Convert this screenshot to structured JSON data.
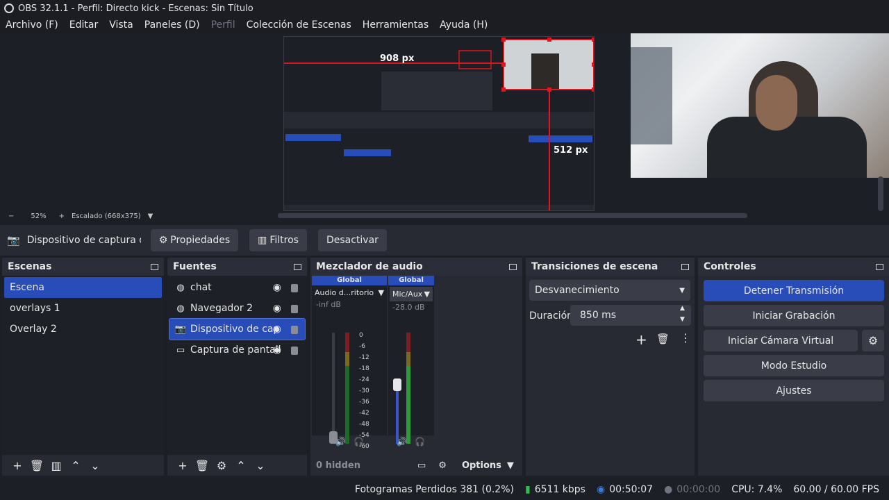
{
  "window": {
    "title": "OBS 32.1.1 - Perfil: Directo kick - Escenas: Sin Título"
  },
  "menu": [
    "Archivo (F)",
    "Editar",
    "Vista",
    "Paneles (D)",
    "Perfil",
    "Colección de Escenas",
    "Herramientas",
    "Ayuda (H)"
  ],
  "preview": {
    "overlay_px_h": "908 px",
    "overlay_px_v": "512 px"
  },
  "zoom": {
    "minus": "−",
    "level": "52%",
    "plus": "+",
    "scaling": "Escalado (668x375)"
  },
  "source_toolbar": {
    "source_name": "Dispositivo de captura de v",
    "properties": "Propiedades",
    "filters": "Filtros",
    "deactivate": "Desactivar"
  },
  "scenes": {
    "title": "Escenas",
    "items": [
      "Escena",
      "overlays 1",
      "Overlay 2"
    ]
  },
  "sources": {
    "title": "Fuentes",
    "items": [
      {
        "label": "chat",
        "icon": "globe-icon"
      },
      {
        "label": "Navegador 2",
        "icon": "globe-icon"
      },
      {
        "label": "Dispositivo de cap",
        "icon": "camera-icon"
      },
      {
        "label": "Captura de pantall",
        "icon": "monitor-icon"
      }
    ]
  },
  "mixer": {
    "title": "Mezclador de audio",
    "channels": [
      {
        "head": "Global",
        "name": "Audio d...ritorio",
        "db": "-inf dB"
      },
      {
        "head": "Global",
        "name": "Mic/Aux",
        "db": "-28.0 dB"
      }
    ],
    "ticks": [
      "0",
      "-6",
      "-12",
      "-18",
      "-24",
      "-30",
      "-36",
      "-42",
      "-48",
      "-54",
      "-60"
    ],
    "hidden": "0 hidden",
    "options": "Options"
  },
  "transitions": {
    "title": "Transiciones de escena",
    "selected": "Desvanecimiento",
    "duration_label": "Duración",
    "duration_value": "850 ms"
  },
  "controls": {
    "title": "Controles",
    "stop_stream": "Detener Transmisión",
    "start_recording": "Iniciar Grabación",
    "start_virtual_cam": "Iniciar Cámara Virtual",
    "studio_mode": "Modo Estudio",
    "settings": "Ajustes"
  },
  "status": {
    "dropped_frames": "Fotogramas Perdidos 381 (0.2%)",
    "bitrate": "6511 kbps",
    "stream_time": "00:50:07",
    "record_time": "00:00:00",
    "cpu": "CPU: 7.4%",
    "fps": "60.00 / 60.00 FPS"
  },
  "colors": {
    "accent": "#284cb8",
    "bg": "#1d1f26",
    "panel": "#272a33"
  }
}
